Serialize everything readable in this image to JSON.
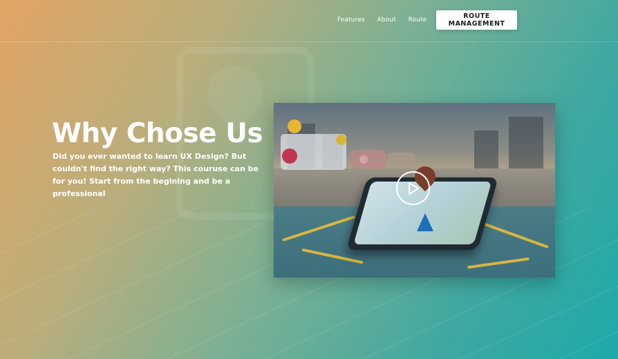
{
  "nav": {
    "items": [
      {
        "label": "Features"
      },
      {
        "label": "About"
      },
      {
        "label": "Route"
      }
    ],
    "cta_label": "ROUTE MANAGEMENT"
  },
  "hero": {
    "title": "Why Chose Us",
    "description": "Did you ever wanted to learn UX Design? But couldn't find the right way? This couruse can be for you! Start from the begining and be a professional"
  },
  "video": {
    "play_icon": "play-icon",
    "thumbnail": "smartphone-map-navigation-street"
  },
  "colors": {
    "gradient_start": "#e2a463",
    "gradient_end": "#1da9aa",
    "text": "#ffffff",
    "cta_bg": "#ffffff"
  }
}
